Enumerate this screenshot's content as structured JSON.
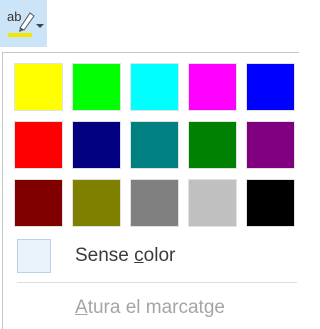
{
  "toolbar": {
    "highlight_icon": "text-highlight-color-icon",
    "highlight_current_color": "#f2e600",
    "dropdown_icon": "chevron-down-icon"
  },
  "palette": {
    "colors": [
      "#ffff00",
      "#00ff00",
      "#00ffff",
      "#ff00ff",
      "#0000ff",
      "#ff0000",
      "#000080",
      "#008080",
      "#008000",
      "#800080",
      "#800000",
      "#808000",
      "#808080",
      "#c0c0c0",
      "#000000"
    ]
  },
  "no_color": {
    "label_pre": "Sense ",
    "label_accel": "c",
    "label_post": "olor"
  },
  "stop_highlighting": {
    "label_accel": "A",
    "label_post": "tura el marcatge",
    "enabled": false
  }
}
